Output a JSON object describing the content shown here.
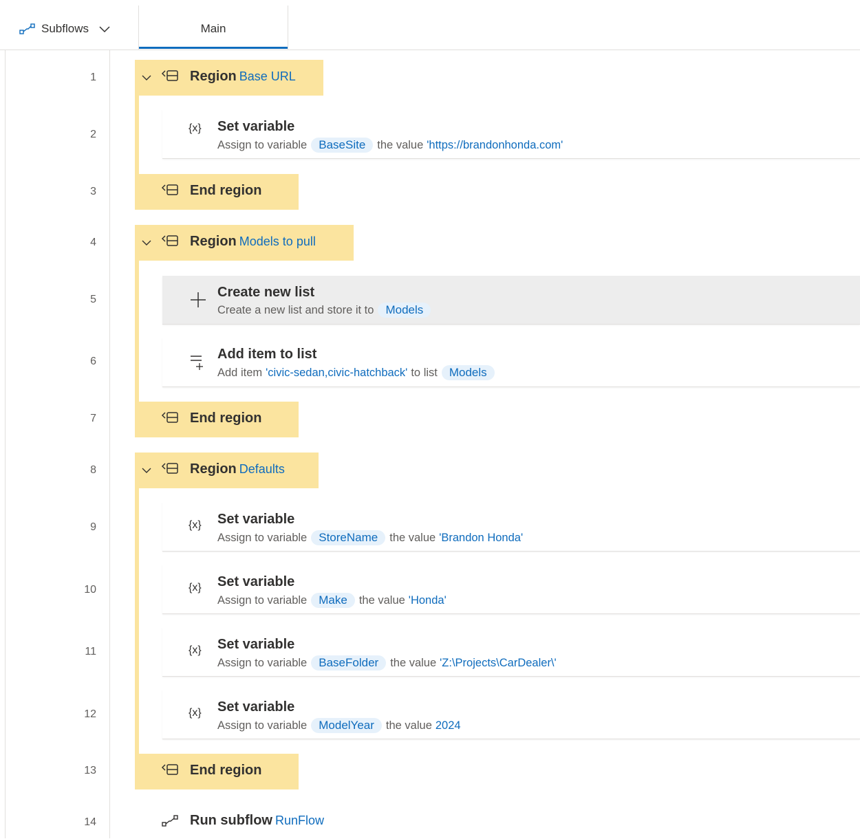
{
  "header": {
    "subflows_label": "Subflows",
    "main_tab": "Main"
  },
  "lines": [
    "1",
    "2",
    "3",
    "4",
    "5",
    "6",
    "7",
    "8",
    "9",
    "10",
    "11",
    "12",
    "13",
    "14"
  ],
  "regions": [
    {
      "keyword": "Region",
      "name": "Base URL",
      "end_label": "End region"
    },
    {
      "keyword": "Region",
      "name": "Models to pull",
      "end_label": "End region"
    },
    {
      "keyword": "Region",
      "name": "Defaults",
      "end_label": "End region"
    }
  ],
  "actions": {
    "set_base": {
      "title": "Set variable",
      "icon": "{x}",
      "prefix": "Assign to variable",
      "variable": "BaseSite",
      "middle": "the value",
      "value": "'https://brandonhonda.com'"
    },
    "create_list": {
      "title": "Create new list",
      "prefix": "Create a new list and store it to",
      "variable": "Models"
    },
    "add_item": {
      "title": "Add item to list",
      "prefix": "Add item",
      "value": "'civic-sedan,civic-hatchback'",
      "middle": "to list",
      "variable": "Models"
    },
    "set_store": {
      "title": "Set variable",
      "icon": "{x}",
      "prefix": "Assign to variable",
      "variable": "StoreName",
      "middle": "the value",
      "value": "'Brandon Honda'"
    },
    "set_make": {
      "title": "Set variable",
      "icon": "{x}",
      "prefix": "Assign to variable",
      "variable": "Make",
      "middle": "the value",
      "value": "'Honda'"
    },
    "set_folder": {
      "title": "Set variable",
      "icon": "{x}",
      "prefix": "Assign to variable",
      "variable": "BaseFolder",
      "middle": "the value",
      "value": "'Z:\\Projects\\CarDealer\\'"
    },
    "set_year": {
      "title": "Set variable",
      "icon": "{x}",
      "prefix": "Assign to variable",
      "variable": "ModelYear",
      "middle": "the value",
      "value": "2024"
    },
    "run_subflow": {
      "title": "Run subflow",
      "name": "RunFlow"
    }
  },
  "colors": {
    "region": "#fbe49f",
    "accent": "#0f6cbd",
    "pill": "#e6f1fb",
    "selected": "#ededed"
  }
}
